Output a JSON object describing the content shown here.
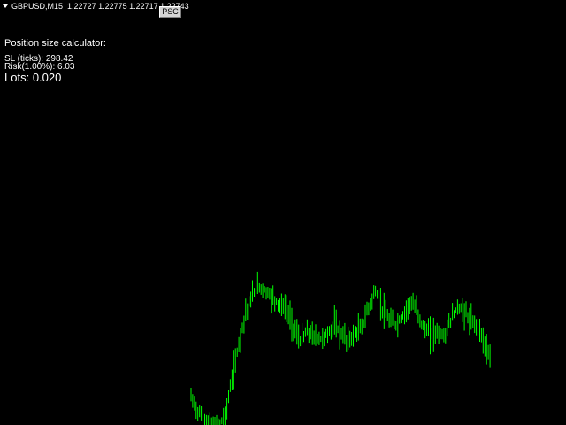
{
  "header": {
    "symbol": "GBPUSD,M15",
    "prices": "1.22727 1.22775 1.22717 1.22743",
    "menu_icon": "caret-down-icon"
  },
  "toolbar": {
    "psc_label": "PSC"
  },
  "calculator": {
    "title": "Position size calculator:",
    "sl_label": "SL (ticks):",
    "sl_value": "298.42",
    "risk_label": "Risk(1.00%):",
    "risk_value": "6.03",
    "lots_label": "Lots:",
    "lots_value": "0.020"
  },
  "colors": {
    "background": "#000000",
    "text": "#ffffff",
    "candles": "#00ff00",
    "entry_line": "#a8a8a8",
    "stop_loss_line": "#c01818",
    "price_line": "#2244ff"
  },
  "chart_data": {
    "type": "line",
    "series": [
      {
        "values": [
          1.2238,
          1.2232,
          1.2228,
          1.2226,
          1.2225,
          1.223,
          1.2246,
          1.2262,
          1.2276,
          1.2283,
          1.2287,
          1.2285,
          1.2282,
          1.2279,
          1.2277,
          1.2269,
          1.2263,
          1.2267,
          1.2265,
          1.2264,
          1.2266,
          1.227,
          1.2266,
          1.2263,
          1.2266,
          1.2269,
          1.2278,
          1.2285,
          1.2277,
          1.2272,
          1.227,
          1.2274,
          1.228,
          1.2277,
          1.2269,
          1.2266,
          1.2267,
          1.2265,
          1.2272,
          1.2278,
          1.2276,
          1.2271,
          1.227,
          1.2262,
          1.225
        ]
      }
    ]
  }
}
